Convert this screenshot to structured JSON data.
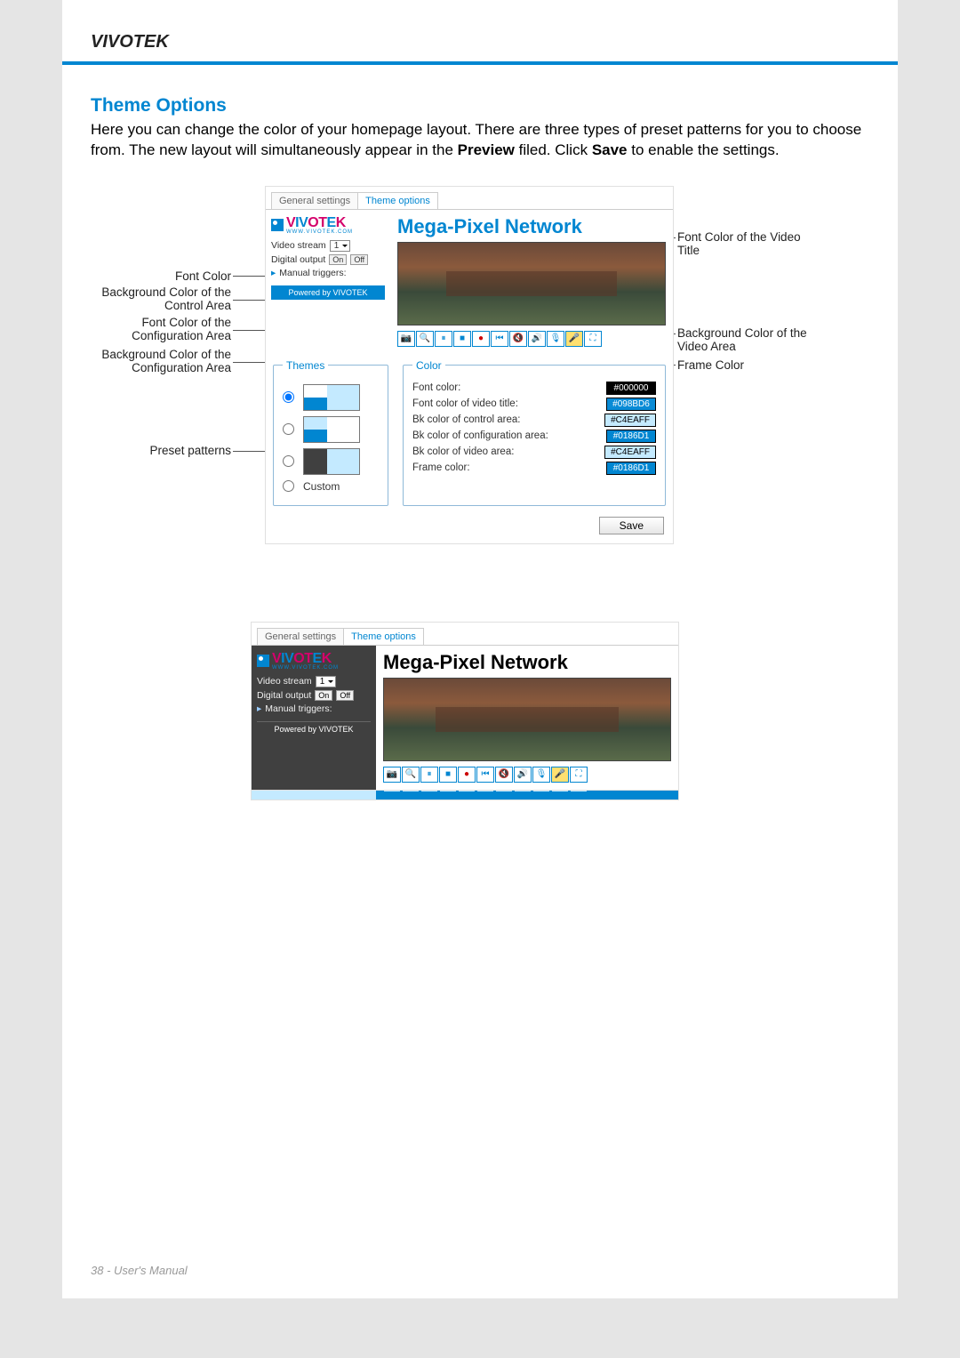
{
  "brand": "VIVOTEK",
  "section_title": "Theme Options",
  "intro_1": "Here you can change the color of your homepage layout. There are three types of preset patterns for you to choose from. The new layout will simultaneously appear in the ",
  "intro_bold1": "Preview",
  "intro_2": " filed. Click ",
  "intro_bold2": "Save",
  "intro_3": " to enable the settings.",
  "callouts": {
    "font_color": "Font Color",
    "bk_control": "Background Color of the Control Area",
    "font_config": "Font Color of the Configuration Area",
    "bk_config": "Background Color of the Configuration Area",
    "preset": "Preset patterns",
    "font_video_title": "Font Color of the Video Title",
    "bk_video": "Background Color of the Video Area",
    "frame_color": "Frame Color"
  },
  "tabs": {
    "general": "General settings",
    "theme": "Theme options"
  },
  "logo": {
    "text": "VIVOTEK",
    "sub": "WWW.VIVOTEK.COM"
  },
  "video_title": "Mega-Pixel Network",
  "controls": {
    "video_stream_label": "Video stream",
    "video_stream_value": "1",
    "digital_output_label": "Digital output",
    "on": "On",
    "off": "Off",
    "manual_triggers": "Manual triggers:",
    "powered": "Powered by VIVOTEK"
  },
  "themes_legend": "Themes",
  "custom": "Custom",
  "color_legend": "Color",
  "colors": {
    "font": {
      "label": "Font color:",
      "value": "#000000",
      "bg": "#000000",
      "fg": "#FFFFFF"
    },
    "font_video": {
      "label": "Font color of video title:",
      "value": "#098BD6",
      "bg": "#098BD6",
      "fg": "#FFFFFF"
    },
    "bk_control": {
      "label": "Bk color of control area:",
      "value": "#C4EAFF",
      "bg": "#C4EAFF",
      "fg": "#000000"
    },
    "bk_config": {
      "label": "Bk color of configuration area:",
      "value": "#0186D1",
      "bg": "#0186D1",
      "fg": "#FFFFFF"
    },
    "bk_video": {
      "label": "Bk color of video area:",
      "value": "#C4EAFF",
      "bg": "#C4EAFF",
      "fg": "#000000"
    },
    "frame": {
      "label": "Frame color:",
      "value": "#0186D1",
      "bg": "#0186D1",
      "fg": "#FFFFFF"
    }
  },
  "save": "Save",
  "footer": "38 - User's Manual"
}
